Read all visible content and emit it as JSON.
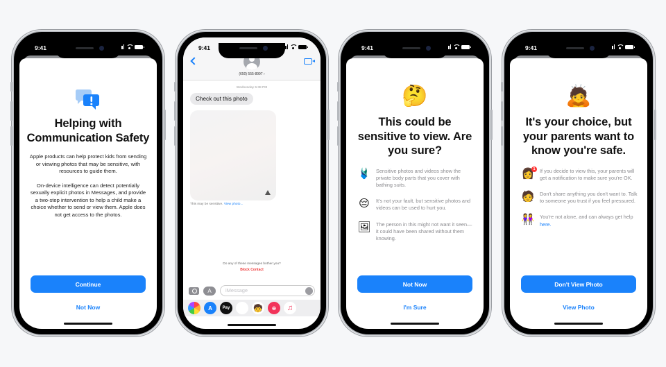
{
  "status_bar": {
    "time": "9:41"
  },
  "phones": [
    {
      "id": "intro",
      "icon": "chat-alert-icon",
      "title": "Helping with Communication Safety",
      "paragraphs": [
        "Apple products can help protect kids from sending or viewing photos that may be sensitive, with resources to guide them.",
        "On-device intelligence can detect potentially sexually explicit photos in Messages, and provide a two-step intervention to help a child make a choice whether to send or view them. Apple does not get access to the photos."
      ],
      "primary_button": "Continue",
      "secondary_button": "Not Now"
    },
    {
      "id": "messages",
      "contact": "(650) 555-8997 ›",
      "timestamp": "Wednesday 5:38 PM",
      "message": "Check out this photo",
      "sensitive_note": "This may be sensitive.",
      "view_photo_link": "View photo...",
      "bother_prompt": "Do any of these messages bother you?",
      "block_contact": "Block Contact",
      "input_placeholder": "iMessage",
      "app_tray": [
        "photos-app-icon",
        "app-store-icon",
        "apple-pay-icon",
        "monkey-memoji-icon",
        "memoji-stickers-icon",
        "image-search-icon",
        "music-icon"
      ],
      "apple_pay_label": "Pay"
    },
    {
      "id": "warning",
      "icon": "thinking-face-emoji",
      "title": "This could be sensitive to view. Are you sure?",
      "tips": [
        {
          "icon": "swimsuit-emoji",
          "text": "Sensitive photos and videos show the private body parts that you cover with bathing suits."
        },
        {
          "icon": "pensive-face-emoji",
          "text": "It's not your fault, but sensitive photos and videos can be used to hurt you."
        },
        {
          "icon": "framed-picture-faces-emoji",
          "text": "The person in this might not want it seen—it could have been shared without them knowing."
        }
      ],
      "primary_button": "Not Now",
      "secondary_button": "I'm Sure"
    },
    {
      "id": "parents",
      "icon": "bowing-person-emoji",
      "title": "It's your choice, but your parents want to know you're safe.",
      "tips": [
        {
          "icon": "parent-notification-memoji",
          "badge": "1",
          "text": "If you decide to view this, your parents will get a notification to make sure you're OK."
        },
        {
          "icon": "share-memoji",
          "text": "Don't share anything you don't want to. Talk to someone you trust if you feel pressured."
        },
        {
          "icon": "friends-memoji",
          "text": "You're not alone, and can always get help ",
          "link": "here."
        }
      ],
      "primary_button": "Don't View Photo",
      "secondary_button": "View Photo"
    }
  ],
  "colors": {
    "accent": "#1a82fb",
    "danger": "#ef3b3b",
    "background": "#f6f7f9"
  }
}
